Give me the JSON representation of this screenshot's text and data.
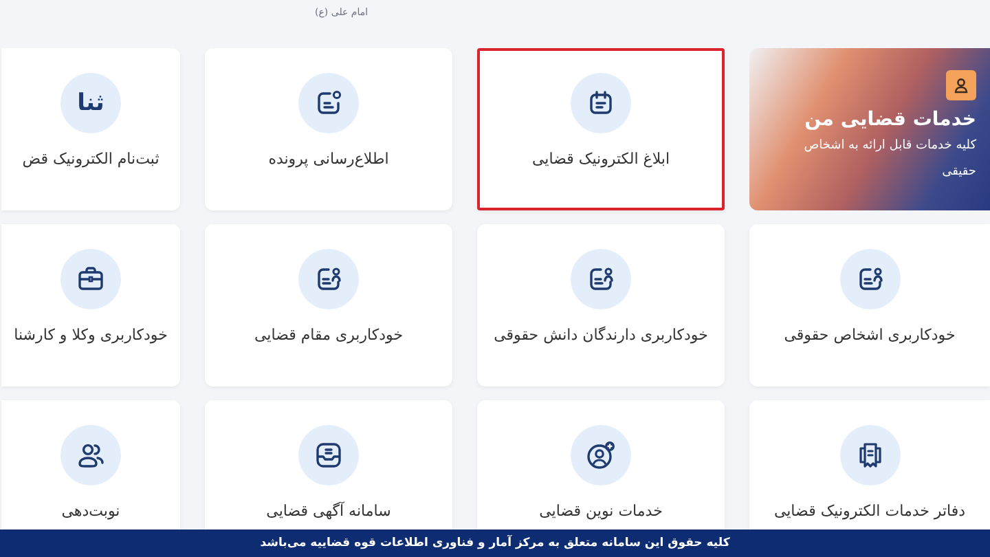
{
  "header": {
    "attribution": "امام علی (ع)"
  },
  "featured": {
    "title": "خدمات قضایی من",
    "description": "کلیه خدمات قابل ارائه به اشخاص حقیقی"
  },
  "services": [
    {
      "label": "ابلاغ الکترونیک قضایی",
      "kind": "calendar",
      "selected": true
    },
    {
      "label": "اطلاع‌رسانی پرونده",
      "kind": "notify",
      "selected": false
    },
    {
      "label": "ثبت‌نام الکترونیک قض",
      "kind": "logo",
      "logo_text": "ثنا",
      "selected": false
    },
    {
      "label": "خودکاربری اشخاص حقوقی",
      "kind": "user-doc",
      "selected": false
    },
    {
      "label": "خودکاربری دارندگان دانش حقوقی",
      "kind": "user-doc",
      "selected": false
    },
    {
      "label": "خودکاربری مقام قضایی",
      "kind": "user-doc",
      "selected": false
    },
    {
      "label": "خودکاربری وکلا و کارشنا",
      "kind": "briefcase",
      "selected": false
    },
    {
      "label": "دفاتر خدمات الکترونیک قضایی",
      "kind": "docs",
      "selected": false
    },
    {
      "label": "خدمات نوین قضایی",
      "kind": "user-plus",
      "selected": false
    },
    {
      "label": "سامانه آگهی قضایی",
      "kind": "inbox",
      "selected": false
    },
    {
      "label": "نوبت‌دهی",
      "kind": "users",
      "selected": false
    }
  ],
  "footer": {
    "text": "کلیه حقوق این سامانه متعلق به مرکز آمار و فناوری اطلاعات قوه قضاییه می‌باشد"
  }
}
